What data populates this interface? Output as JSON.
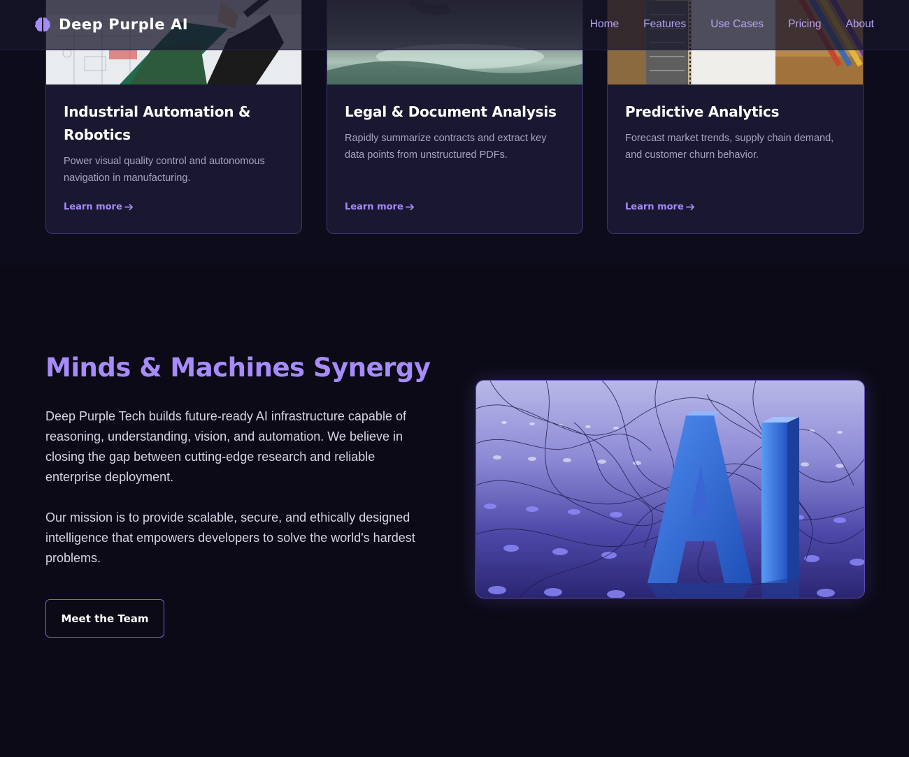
{
  "brand": {
    "name": "Deep Purple AI",
    "icon": "brain-icon"
  },
  "nav": {
    "links": [
      "Home",
      "Features",
      "Use Cases",
      "Pricing",
      "About"
    ]
  },
  "use_cases": [
    {
      "title": "Industrial Automation & Robotics",
      "description": "Power visual quality control and autonomous navigation in manufacturing.",
      "link": "Learn more",
      "image": "workshop-blueprint-photo"
    },
    {
      "title": "Legal & Document Analysis",
      "description": "Rapidly summarize contracts and extract key data points from unstructured PDFs.",
      "link": "Learn more",
      "image": "document-review-photo"
    },
    {
      "title": "Predictive Analytics",
      "description": "Forecast market trends, supply chain demand, and customer churn behavior.",
      "link": "Learn more",
      "image": "analytics-desk-photo"
    }
  ],
  "synergy": {
    "title": "Minds & Machines Synergy",
    "paragraph1": "Deep Purple Tech builds future-ready AI infrastructure capable of reasoning, understanding, vision, and automation. We believe in closing the gap between cutting-edge research and reliable enterprise deployment.",
    "paragraph2": "Our mission is to provide scalable, secure, and ethically designed intelligence that empowers developers to solve the world's hardest problems.",
    "button": "Meet the Team",
    "image": "ai-letters-network-illustration"
  },
  "colors": {
    "accent": "#a78bfa",
    "nav_link": "#b8a6f7",
    "card_bg": "#1a1830",
    "card_border": "#3b3270",
    "page_bg": "#0d0c1a",
    "section_bg": "#0b0a16"
  }
}
